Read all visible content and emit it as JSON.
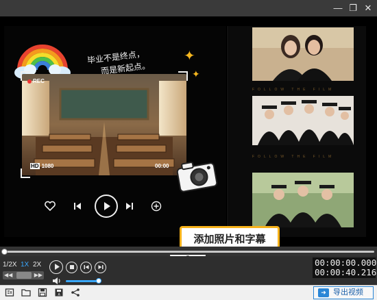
{
  "window": {
    "minimize_icon": "minimize-icon",
    "restore_icon": "restore-icon",
    "close_icon": "close-icon"
  },
  "preview": {
    "handwriting_line1": "毕业不是终点，",
    "handwriting_line2": "而是新起点。",
    "rec_label": "REC",
    "hd_badge": "HD",
    "resolution": "1080",
    "overlay_time": "00:00",
    "film_caption": "FOLLOW THE FILM"
  },
  "tooltip": {
    "text": "添加照片和字幕"
  },
  "playback": {
    "speeds": [
      "1/2X",
      "1X",
      "2X"
    ],
    "active_speed": "1X",
    "current_time": "00:00:00.000",
    "total_time": "00:00:40.216",
    "progress": 0.0,
    "volume": 1.0
  },
  "toolbar": {
    "export_label": "导出视频"
  },
  "colors": {
    "accent": "#39a8ff",
    "tooltip_border": "#f7b21a",
    "export_border": "#2a86d6"
  }
}
